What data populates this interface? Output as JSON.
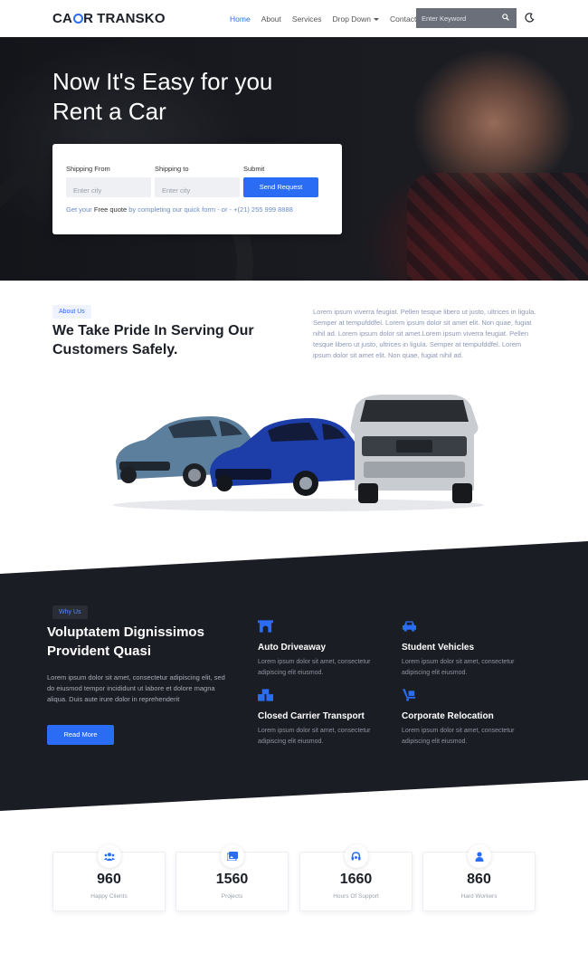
{
  "brand": {
    "part1": "C",
    "part2": "R",
    "part3": "TRANSKO"
  },
  "nav": {
    "items": [
      "Home",
      "About",
      "Services",
      "Drop Down",
      "Contact"
    ],
    "search_placeholder": "Enter Keyword"
  },
  "hero": {
    "title": "Now It's Easy for you Rent a Car",
    "form": {
      "from_label": "Shipping From",
      "from_placeholder": "Enter city",
      "to_label": "Shipping to",
      "to_placeholder": "Enter city",
      "submit_label": "Submit",
      "button": "Send Request",
      "note_pre": "Get your",
      "note_free": "Free quote",
      "note_post": "by completing our quick form - or -",
      "phone": "+(21) 255 999 8888"
    }
  },
  "about": {
    "pill": "About Us",
    "title": "We Take Pride In Serving Our Customers Safely.",
    "text": "Lorem ipsum viverra feugiat. Pellen tesque libero ut justo, ultrices in ligula. Semper at tempufddfel. Lorem ipsum dolor sit amet elit. Non quae, fugiat nihil ad. Lorem ipsum dolor sit amet.Lorem ipsum viverra feugiat. Pellen tesque libero ut justo, ultrices in ligula. Semper at tempufddfel. Lorem ipsum dolor sit amet elit. Non quae, fugiat nihil ad."
  },
  "why": {
    "pill": "Why Us",
    "title": "Voluptatem Dignissimos Provident Quasi",
    "text": "Lorem ipsum dolor sit amet, consectetur adipiscing elit, sed do eiusmod tempor incididunt ut labore et dolore magna aliqua. Duis aute irure dolor in reprehenderit",
    "button": "Read More",
    "features": [
      {
        "icon": "arch-icon",
        "title": "Auto Driveaway",
        "text": "Lorem ipsum dolor sit amet, consectetur adipiscing elit eiusmod."
      },
      {
        "icon": "car-icon",
        "title": "Student Vehicles",
        "text": "Lorem ipsum dolor sit amet, consectetur adipiscing elit eiusmod."
      },
      {
        "icon": "boxes-icon",
        "title": "Closed Carrier Transport",
        "text": "Lorem ipsum dolor sit amet, consectetur adipiscing elit eiusmod."
      },
      {
        "icon": "dolly-icon",
        "title": "Corporate Relocation",
        "text": "Lorem ipsum dolor sit amet, consectetur adipiscing elit eiusmod."
      }
    ]
  },
  "stats": [
    {
      "icon": "users-icon",
      "value": "960",
      "label": "Happy Clients"
    },
    {
      "icon": "images-icon",
      "value": "1560",
      "label": "Projects"
    },
    {
      "icon": "headset-icon",
      "value": "1660",
      "label": "Hours Of Support"
    },
    {
      "icon": "worker-icon",
      "value": "860",
      "label": "Hard Workers"
    }
  ],
  "colors": {
    "accent": "#2a6df4",
    "dark": "#1b1d24"
  }
}
